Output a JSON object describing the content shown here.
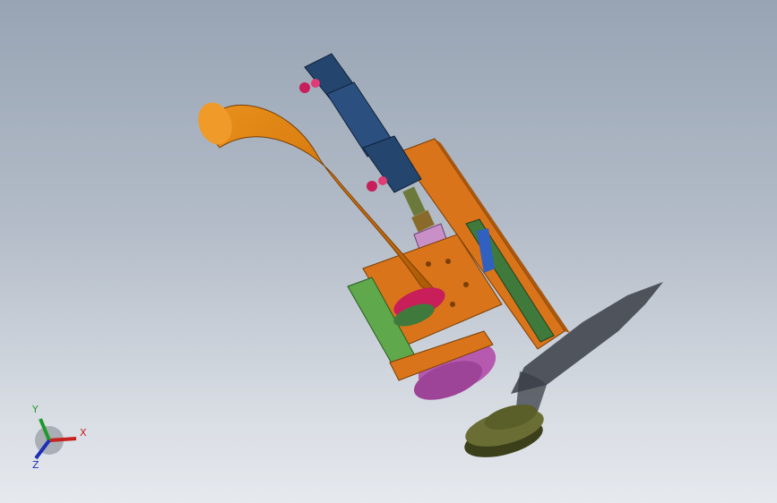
{
  "scene": {
    "background_top": "#98a4b4",
    "background_bottom": "#e6e9ee",
    "parts": [
      {
        "name": "bent-tube",
        "color": "#d67a0e"
      },
      {
        "name": "cylinder-actuator",
        "color": "#24466e"
      },
      {
        "name": "pneumatic-fittings",
        "color": "#c81e5a"
      },
      {
        "name": "back-plate",
        "color": "#d9741a"
      },
      {
        "name": "linear-rail",
        "color": "#3f7a3c"
      },
      {
        "name": "side-bracket",
        "color": "#5fa84c"
      },
      {
        "name": "slider-block",
        "color": "#c98fc7"
      },
      {
        "name": "rotary-housing",
        "color": "#b65ab0"
      },
      {
        "name": "puck-part",
        "color": "#4f5325"
      }
    ]
  },
  "triad": {
    "x_label": "X",
    "y_label": "Y",
    "z_label": "Z",
    "x_color": "#c8201e",
    "y_color": "#1f9a2a",
    "z_color": "#1c2fb8"
  }
}
